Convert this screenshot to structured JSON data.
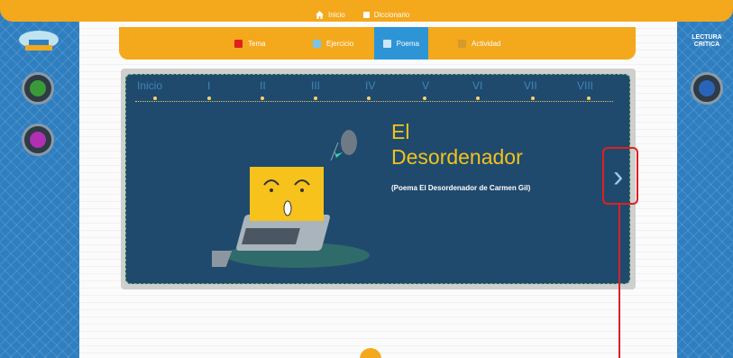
{
  "topbar": {
    "home_label": "Inicio",
    "dict_label": "Diccionario"
  },
  "tabs": [
    {
      "label": "Tema",
      "active": false
    },
    {
      "label": "Ejercicio",
      "active": false
    },
    {
      "label": "Poema",
      "active": true
    },
    {
      "label": "Actividad",
      "active": false
    }
  ],
  "timeline": [
    "Inicio",
    "I",
    "II",
    "III",
    "IV",
    "V",
    "VI",
    "VII",
    "VIII"
  ],
  "slide": {
    "title_line1": "El",
    "title_line2": "Desordenador",
    "subtitle": "(Poema El Desordenador de Carmen Gil)"
  },
  "right_panel": {
    "line1": "LECTURA",
    "line2": "CRITICA"
  },
  "colors": {
    "orange": "#f4a81c",
    "navy": "#1f4a6e",
    "blue": "#2d95d6",
    "title": "#f4c21b",
    "highlight": "#e0201f"
  },
  "icons": {
    "home": "home-icon",
    "dictionary": "dictionary-icon",
    "next": "chevron-right-icon"
  }
}
